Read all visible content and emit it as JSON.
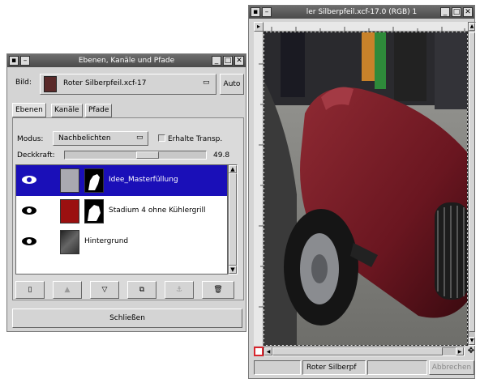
{
  "layers_dialog": {
    "title": "Ebenen, Kanäle und Pfade",
    "image_label": "Bild:",
    "image_name": "Roter Silberpfeil.xcf-17",
    "auto_label": "Auto",
    "tabs": [
      "Ebenen",
      "Kanäle",
      "Pfade"
    ],
    "mode_label": "Modus:",
    "mode_value": "Nachbelichten",
    "keep_transparency_label": "Erhalte Transp.",
    "opacity_label": "Deckkraft:",
    "opacity_value": "49.8",
    "opacity_fraction": 0.6,
    "layers": [
      {
        "name": "Idee_Masterfüllung",
        "selected": true
      },
      {
        "name": "Stadium 4 ohne Kühlergrill",
        "selected": false
      },
      {
        "name": "Hintergrund",
        "selected": false
      }
    ],
    "anchor_glyph": "⚓",
    "delete_glyph": "🗑",
    "close_button_label": "Schließen"
  },
  "image_window": {
    "title": "ler Silberpfeil.xcf-17.0 (RGB) 1",
    "status_name": "Roter Silberpf",
    "cancel_label": "Abbrechen"
  },
  "colors": {
    "selection_blue": "#1a0fb8",
    "car_red": "#7a1b24",
    "titlebar_gray": "#5a5a5a"
  }
}
